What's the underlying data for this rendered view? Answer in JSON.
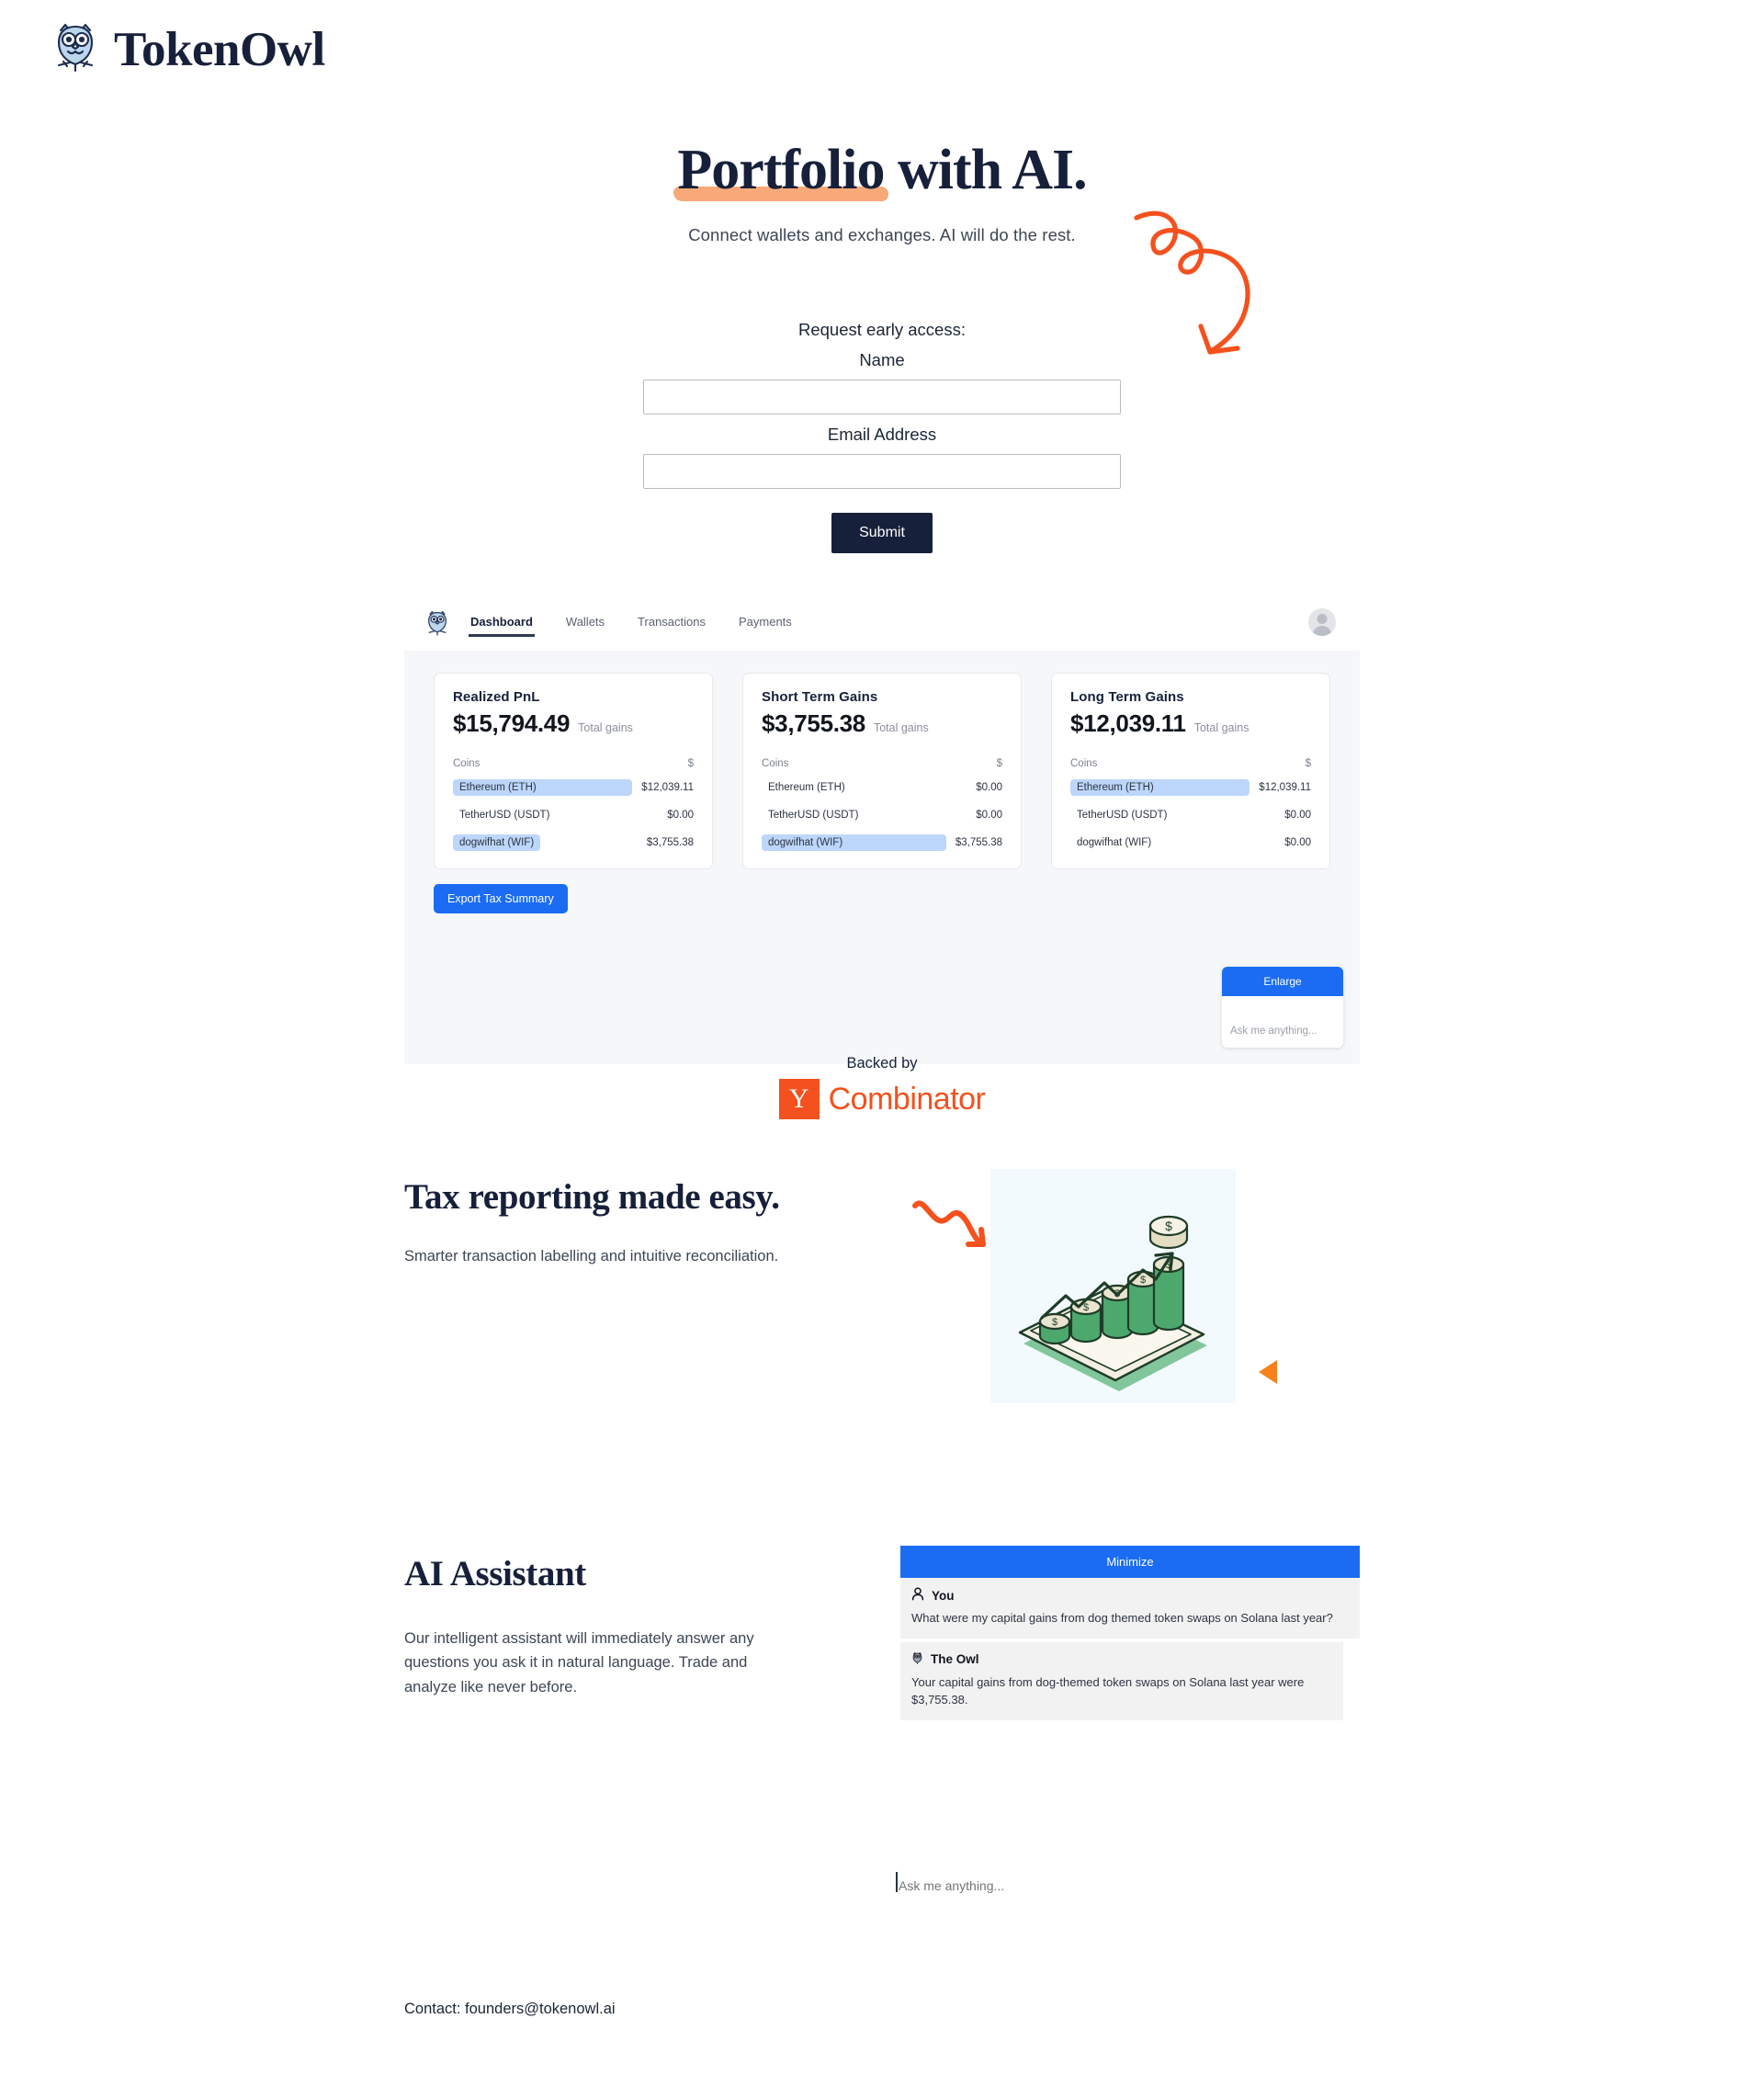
{
  "brand": {
    "name": "TokenOwl",
    "logo_icon": "owl-icon"
  },
  "hero": {
    "title_highlighted": "Portfolio",
    "title_rest": " with AI.",
    "subtitle": "Connect wallets and exchanges. AI will do the rest.",
    "arrow_icon": "curly-arrow-icon"
  },
  "form": {
    "prompt": "Request early access:",
    "name_label": "Name",
    "name_value": "",
    "name_placeholder": "",
    "email_label": "Email Address",
    "email_value": "",
    "email_placeholder": "",
    "submit_label": "Submit"
  },
  "dashboard": {
    "logo_icon": "owl-icon",
    "avatar_icon": "user-avatar-icon",
    "tabs": [
      {
        "label": "Dashboard",
        "active": true
      },
      {
        "label": "Wallets",
        "active": false
      },
      {
        "label": "Transactions",
        "active": false
      },
      {
        "label": "Payments",
        "active": false
      }
    ],
    "column_headers": {
      "coins": "Coins",
      "value": "$"
    },
    "cards": [
      {
        "title": "Realized PnL",
        "amount": "$15,794.49",
        "amount_label": "Total gains",
        "rows": [
          {
            "coin": "Ethereum (ETH)",
            "value": "$12,039.11",
            "highlight": "full"
          },
          {
            "coin": "TetherUSD (USDT)",
            "value": "$0.00",
            "highlight": "none"
          },
          {
            "coin": "dogwifhat (WIF)",
            "value": "$3,755.38",
            "highlight": "partial"
          }
        ]
      },
      {
        "title": "Short Term Gains",
        "amount": "$3,755.38",
        "amount_label": "Total gains",
        "rows": [
          {
            "coin": "Ethereum (ETH)",
            "value": "$0.00",
            "highlight": "none"
          },
          {
            "coin": "TetherUSD (USDT)",
            "value": "$0.00",
            "highlight": "none"
          },
          {
            "coin": "dogwifhat (WIF)",
            "value": "$3,755.38",
            "highlight": "full"
          }
        ]
      },
      {
        "title": "Long Term Gains",
        "amount": "$12,039.11",
        "amount_label": "Total gains",
        "rows": [
          {
            "coin": "Ethereum (ETH)",
            "value": "$12,039.11",
            "highlight": "full"
          },
          {
            "coin": "TetherUSD (USDT)",
            "value": "$0.00",
            "highlight": "none"
          },
          {
            "coin": "dogwifhat (WIF)",
            "value": "$0.00",
            "highlight": "none"
          }
        ]
      }
    ],
    "export_label": "Export Tax Summary",
    "chat_widget": {
      "enlarge_label": "Enlarge",
      "input_placeholder": "Ask me anything..."
    }
  },
  "backed_by": {
    "label": "Backed by",
    "brand_mark": "Y",
    "brand_name": "Combinator",
    "color": "#f4511e"
  },
  "tax_section": {
    "heading": "Tax reporting made easy.",
    "body": "Smarter transaction labelling and intuitive reconciliation.",
    "image_icon": "bar-chart-coins-illustration",
    "squiggle_icon": "zigzag-arrow-icon",
    "triangle_icon": "left-triangle-icon"
  },
  "ai_section": {
    "heading": "AI Assistant",
    "body": "Our intelligent assistant will immediately answer any questions you ask it in natural language. Trade and analyze like never before.",
    "minimize_label": "Minimize",
    "messages": [
      {
        "author": "You",
        "icon": "person-icon",
        "text": "What were my capital gains from dog themed token swaps on Solana last year?"
      },
      {
        "author": "The Owl",
        "icon": "owl-icon",
        "text": "Your capital gains from dog-themed token swaps on Solana last year were $3,755.38."
      }
    ],
    "input_placeholder": "Ask me anything...",
    "input_value": ""
  },
  "footer": {
    "contact": "Contact: founders@tokenowl.ai"
  },
  "colors": {
    "accent_blue": "#1b6cf3",
    "accent_orange": "#f4511e",
    "ink": "#17203a",
    "highlight_peach": "#f7a97a",
    "row_highlight": "#bdd6fb"
  }
}
